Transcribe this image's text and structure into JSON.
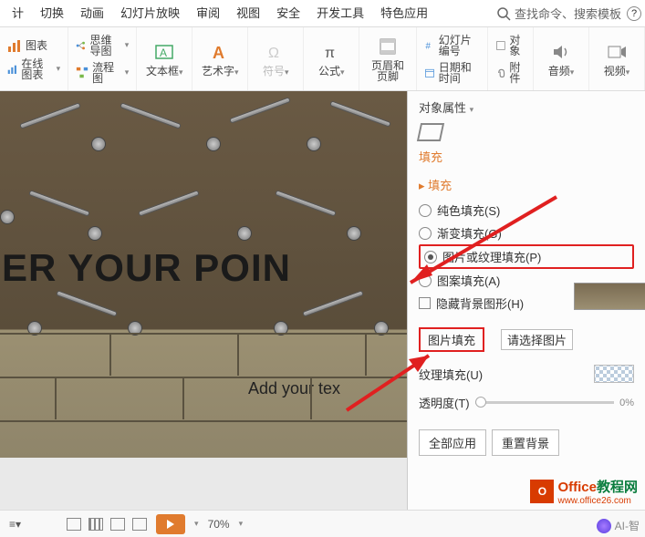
{
  "tabs": [
    "计",
    "切换",
    "动画",
    "幻灯片放映",
    "审阅",
    "视图",
    "安全",
    "开发工具",
    "特色应用"
  ],
  "search_placeholder": "查找命令、搜索模板",
  "ribbon": {
    "chart": "图表",
    "online_chart": "在线图表",
    "mindmap": "思维导图",
    "flowchart": "流程图",
    "textbox": "文本框",
    "wordart": "艺术字",
    "symbol": "符号",
    "formula": "公式",
    "header_footer": "页眉和页脚",
    "slide_number": "幻灯片编号",
    "datetime": "日期和时间",
    "object": "对象",
    "attachment": "附件",
    "audio": "音频",
    "video": "视频"
  },
  "slide": {
    "title": "ER YOUR POIN",
    "sub": "Add your tex"
  },
  "panel": {
    "title": "对象属性",
    "tab_fill": "填充",
    "section_fill": "填充",
    "solid": "纯色填充(S)",
    "gradient": "渐变填充(G)",
    "picture_texture": "图片或纹理填充(P)",
    "pattern": "图案填充(A)",
    "hide_bg": "隐藏背景图形(H)",
    "pic_fill": "图片填充",
    "select_pic": "请选择图片",
    "tex_fill": "纹理填充(U)",
    "opacity": "透明度(T)",
    "opacity_val": "0%",
    "apply_all": "全部应用",
    "reset_bg": "重置背景"
  },
  "status": {
    "zoom": "70%",
    "ai": "AI-智"
  },
  "watermark": {
    "brand1": "Office",
    "brand2": "教程网",
    "url": "www.office26.com"
  }
}
